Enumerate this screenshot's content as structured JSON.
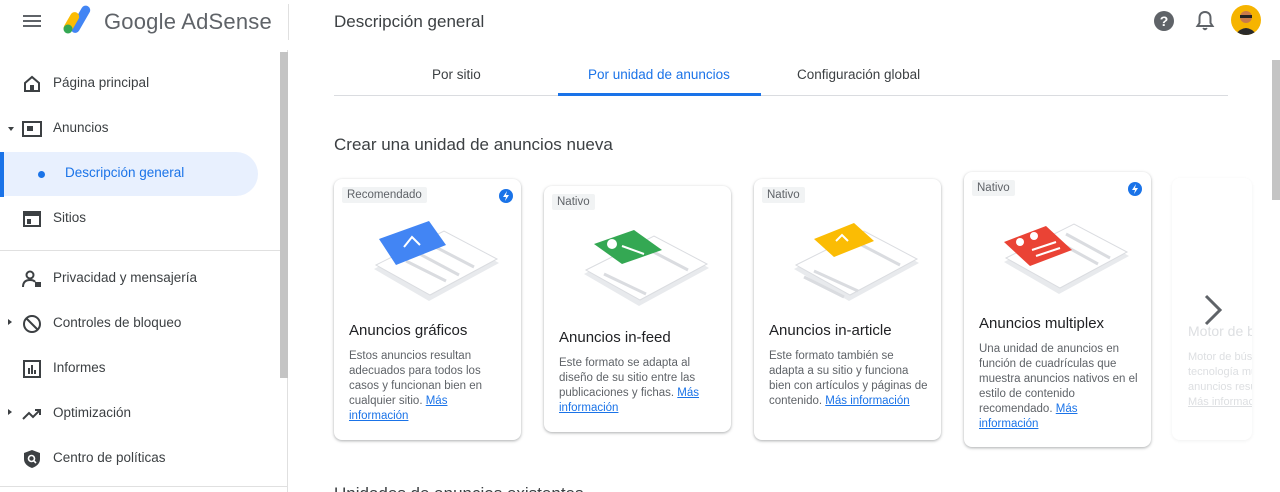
{
  "header": {
    "brand": "Google AdSense",
    "page_title": "Descripción general",
    "help_label": "?"
  },
  "sidebar": {
    "items": [
      {
        "label": "Página principal",
        "icon": "home-icon"
      },
      {
        "label": "Anuncios",
        "icon": "ads-icon"
      },
      {
        "label": "Descripción general",
        "icon": "dot"
      },
      {
        "label": "Sitios",
        "icon": "sites-icon"
      },
      {
        "label": "Privacidad y mensajería",
        "icon": "privacy-icon"
      },
      {
        "label": "Controles de bloqueo",
        "icon": "block-icon"
      },
      {
        "label": "Informes",
        "icon": "reports-icon"
      },
      {
        "label": "Optimización",
        "icon": "optimization-icon"
      },
      {
        "label": "Centro de políticas",
        "icon": "policy-icon"
      }
    ]
  },
  "tabs": [
    {
      "label": "Por sitio"
    },
    {
      "label": "Por unidad de anuncios"
    },
    {
      "label": "Configuración global"
    }
  ],
  "section_title": "Crear una unidad de anuncios nueva",
  "section_title2": "Unidades de anuncios existentes",
  "cards": [
    {
      "tag": "Recomendado",
      "title": "Anuncios gráficos",
      "desc": "Estos anuncios resultan adecuados para todos los casos y funcionan bien en cualquier sitio.",
      "link": "Más información",
      "accent": "#4285f4"
    },
    {
      "tag": "Nativo",
      "title": "Anuncios in-feed",
      "desc": "Este formato se adapta al diseño de su sitio entre las publicaciones y fichas.",
      "link": "Más información",
      "accent": "#34a853"
    },
    {
      "tag": "Nativo",
      "title": "Anuncios in-article",
      "desc": "Este formato también se adapta a su sitio y funciona bien con artículos y páginas de contenido.",
      "link": "Más información",
      "accent": "#fbbc04"
    },
    {
      "tag": "Nativo",
      "title": "Anuncios multiplex",
      "desc": "Una unidad de anuncios en función de cuadrículas que muestra anuncios nativos en el estilo de contenido recomendado.",
      "link": "Más información",
      "accent": "#ea4335"
    }
  ],
  "faded_card": {
    "title": "Motor de búsqueda",
    "desc": "Motor de búsqueda tecnología muestra anuncios resultados",
    "link": "Más información"
  },
  "colors": {
    "primary": "#1a73e8",
    "active_bg": "#e8f0fe"
  }
}
